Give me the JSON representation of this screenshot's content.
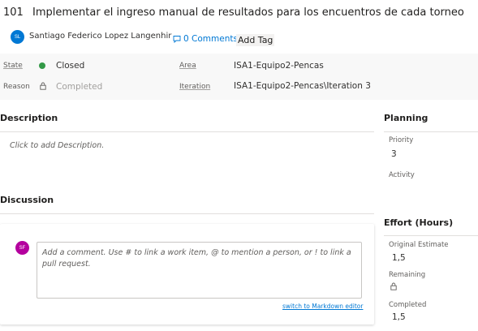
{
  "work_item": {
    "id": "101",
    "title": "Implementar el ingreso manual de resultados para los encuentros de cada torneo"
  },
  "assignee": {
    "initials": "SL",
    "name": "Santiago Federico Lopez Langenhir",
    "avatar_color": "#0078d4"
  },
  "comments_link": {
    "label": "0 Comments",
    "icon": "comment-icon"
  },
  "add_tag": {
    "label": "Add Tag"
  },
  "fields": {
    "state": {
      "label": "State",
      "value": "Closed",
      "dot_color": "#339947"
    },
    "reason": {
      "label": "Reason",
      "value": "Completed",
      "icon": "lock-icon"
    },
    "area": {
      "label": "Area",
      "value": "ISA1-Equipo2-Pencas"
    },
    "iteration": {
      "label": "Iteration",
      "value": "ISA1-Equipo2-Pencas\\Iteration 3"
    }
  },
  "description": {
    "heading": "Description",
    "placeholder": "Click to add Description."
  },
  "discussion": {
    "heading": "Discussion",
    "avatar_initials": "SF",
    "avatar_color": "#b4009e",
    "comment_placeholder": "Add a comment. Use # to link a work item, @ to mention a person, or ! to link a pull request.",
    "markdown_link": "switch to Markdown editor"
  },
  "planning": {
    "heading": "Planning",
    "priority_label": "Priority",
    "priority_value": "3",
    "activity_label": "Activity"
  },
  "effort": {
    "heading": "Effort (Hours)",
    "original_estimate_label": "Original Estimate",
    "original_estimate_value": "1,5",
    "remaining_label": "Remaining",
    "completed_label": "Completed",
    "completed_value": "1,5"
  }
}
